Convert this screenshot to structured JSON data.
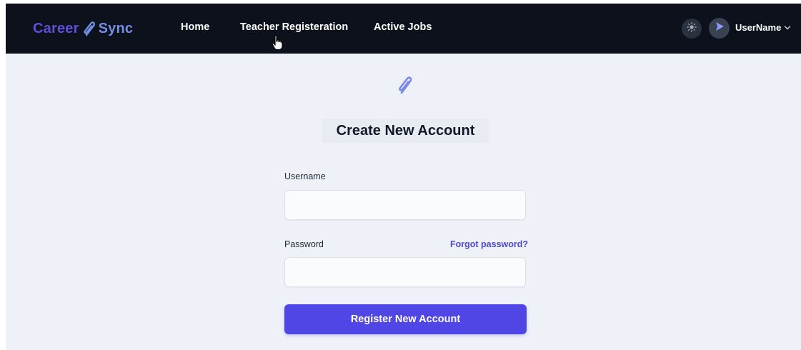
{
  "brand": {
    "part1": "Career",
    "part2": "Sync"
  },
  "nav": {
    "home": "Home",
    "teacher_registration": "Teacher Registeration",
    "active_jobs": "Active Jobs"
  },
  "user_menu": {
    "name": "UserName"
  },
  "form": {
    "title": "Create New Account",
    "username_label": "Username",
    "username_value": "",
    "password_label": "Password",
    "password_value": "",
    "forgot_link": "Forgot password?",
    "submit_label": "Register New Account"
  },
  "icons": {
    "brand_icon": "paperclip-icon",
    "logo_mark": "paperclip-icon",
    "theme_toggle": "sun-icon",
    "avatar": "send-arrow-icon",
    "dropdown": "chevron-down-icon",
    "cursor": "hand-pointer-cursor"
  },
  "colors": {
    "navbar_bg": "#0d111c",
    "page_bg": "#eef2f8",
    "brand_primary": "#5b50d6",
    "brand_secondary": "#6f8fe0",
    "accent": "#4f46e5",
    "link": "#5148c9"
  }
}
